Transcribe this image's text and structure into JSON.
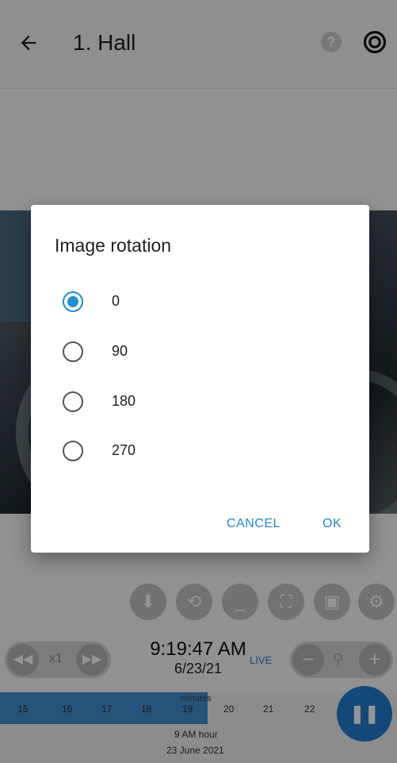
{
  "header": {
    "title": "1. Hall",
    "back_icon": "arrow-left-icon",
    "help_icon": "help-icon",
    "lens_icon": "lens-icon"
  },
  "dialog": {
    "title": "Image rotation",
    "options": [
      {
        "label": "0",
        "checked": true
      },
      {
        "label": "90",
        "checked": false
      },
      {
        "label": "180",
        "checked": false
      },
      {
        "label": "270",
        "checked": false
      }
    ],
    "cancel_label": "CANCEL",
    "ok_label": "OK"
  },
  "playback": {
    "speed_label": "x1",
    "time": "9:19:47 AM",
    "date": "6/23/21",
    "live_label": "LIVE"
  },
  "timeline": {
    "top_label": "minutes",
    "ticks": [
      "15",
      "16",
      "17",
      "18",
      "19",
      "20",
      "21",
      "22"
    ],
    "hour_label": "9 AM hour",
    "date_label": "23 June 2021"
  },
  "colors": {
    "accent": "#1e90d2",
    "fab": "#1f7ed0"
  }
}
